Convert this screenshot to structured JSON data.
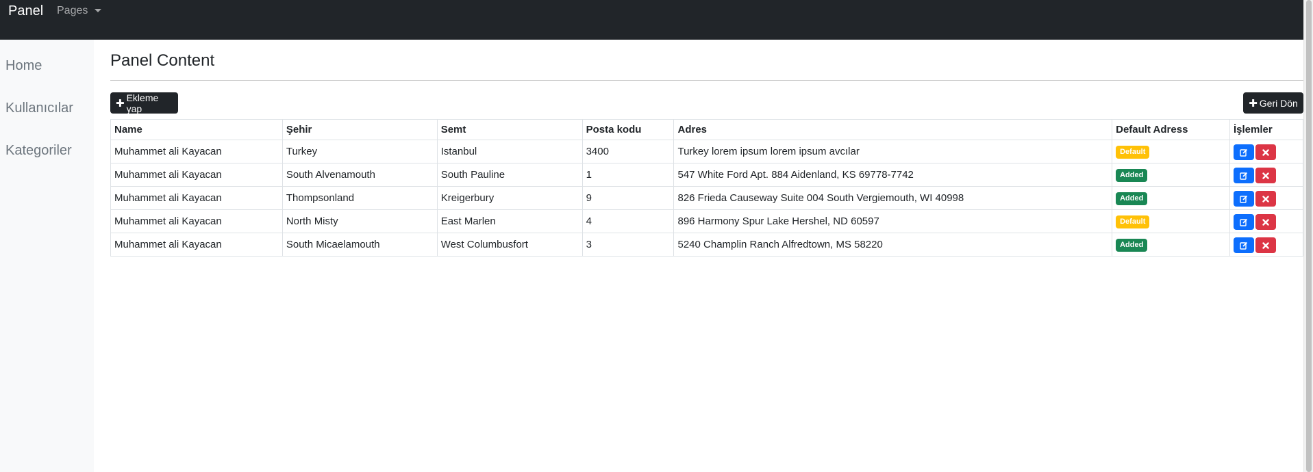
{
  "navbar": {
    "brand": "Panel",
    "pages_label": "Pages"
  },
  "sidebar": {
    "items": [
      {
        "label": "Home"
      },
      {
        "label": "Kullanıcılar"
      },
      {
        "label": "Kategoriler"
      }
    ]
  },
  "main": {
    "title": "Panel Content",
    "add_button": "Ekleme yap",
    "back_button": "Geri Dön",
    "table": {
      "headers": [
        "Name",
        "Şehir",
        "Semt",
        "Posta kodu",
        "Adres",
        "Default Adress",
        "İşlemler"
      ],
      "rows": [
        {
          "name": "Muhammet ali Kayacan",
          "sehir": "Turkey",
          "semt": "Istanbul",
          "posta": "3400",
          "adres": "Turkey lorem ipsum lorem ipsum avcılar",
          "status": "Default"
        },
        {
          "name": "Muhammet ali Kayacan",
          "sehir": "South Alvenamouth",
          "semt": "South Pauline",
          "posta": "1",
          "adres": "547 White Ford Apt. 884 Aidenland, KS 69778-7742",
          "status": "Added"
        },
        {
          "name": "Muhammet ali Kayacan",
          "sehir": "Thompsonland",
          "semt": "Kreigerbury",
          "posta": "9",
          "adres": "826 Frieda Causeway Suite 004 South Vergiemouth, WI 40998",
          "status": "Added"
        },
        {
          "name": "Muhammet ali Kayacan",
          "sehir": "North Misty",
          "semt": "East Marlen",
          "posta": "4",
          "adres": "896 Harmony Spur Lake Hershel, ND 60597",
          "status": "Default"
        },
        {
          "name": "Muhammet ali Kayacan",
          "sehir": "South Micaelamouth",
          "semt": "West Columbusfort",
          "posta": "3",
          "adres": "5240 Champlin Ranch Alfredtown, MS 58220",
          "status": "Added"
        }
      ]
    }
  },
  "icons": {
    "edit": "edit-icon",
    "delete": "delete-x-icon",
    "plus": "plus-icon",
    "caret": "caret-down-icon"
  },
  "colors": {
    "navbar": "#212529",
    "badge_default": "#ffc107",
    "badge_added": "#198754",
    "edit": "#0d6efd",
    "delete": "#dc3545"
  }
}
